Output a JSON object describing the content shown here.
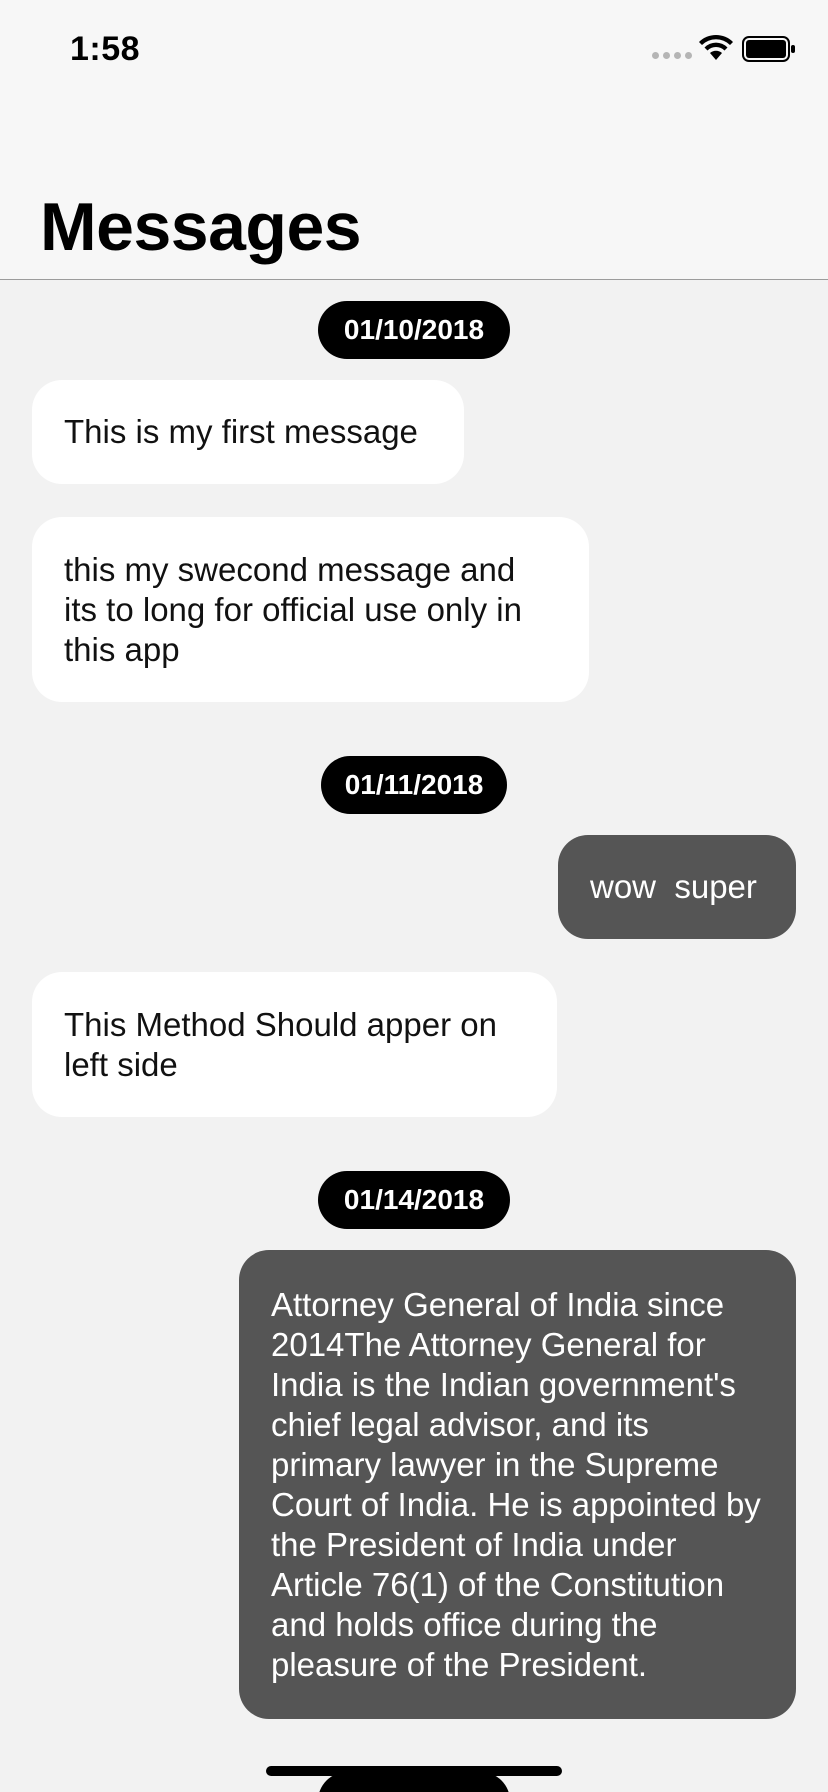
{
  "status_bar": {
    "time": "1:58"
  },
  "header": {
    "title": "Messages"
  },
  "messages": {
    "date_1": "01/10/2018",
    "msg_1": "This is my first message",
    "msg_2": "this my swecond message and its to long for official use only in this app",
    "date_2": "01/11/2018",
    "msg_3": "wow  super",
    "msg_4": "This Method Should apper on left side",
    "date_3": "01/14/2018",
    "msg_5": "Attorney General of India since 2014The Attorney General for India is the Indian government's chief legal advisor, and its primary lawyer in the Supreme Court of India. He is appointed by the President of India under Article 76(1) of the Constitution and holds office during the pleasure of the President."
  },
  "colors": {
    "incoming_bubble": "#ffffff",
    "outgoing_bubble": "#555555",
    "date_pill": "#000000",
    "background": "#f2f2f2"
  },
  "icons": [
    "cellular-signal-icon",
    "wifi-icon",
    "battery-icon"
  ]
}
